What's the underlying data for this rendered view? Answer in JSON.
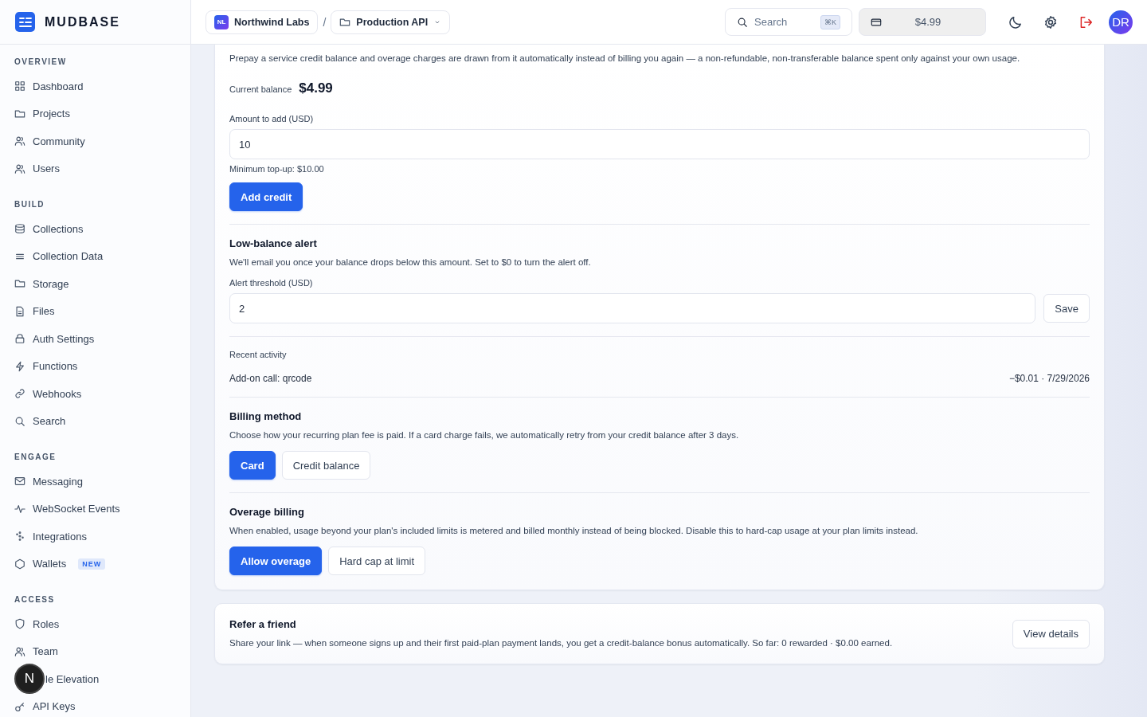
{
  "brand": {
    "name": "MUDBASE"
  },
  "sidebar": {
    "sections": [
      {
        "title": "OVERVIEW",
        "items": [
          {
            "label": "Dashboard"
          },
          {
            "label": "Projects"
          },
          {
            "label": "Community"
          },
          {
            "label": "Users"
          }
        ]
      },
      {
        "title": "BUILD",
        "items": [
          {
            "label": "Collections"
          },
          {
            "label": "Collection Data"
          },
          {
            "label": "Storage"
          },
          {
            "label": "Files"
          },
          {
            "label": "Auth Settings"
          },
          {
            "label": "Functions"
          },
          {
            "label": "Webhooks"
          },
          {
            "label": "Search"
          }
        ]
      },
      {
        "title": "ENGAGE",
        "items": [
          {
            "label": "Messaging"
          },
          {
            "label": "WebSocket Events"
          },
          {
            "label": "Integrations"
          },
          {
            "label": "Wallets",
            "badge": "NEW"
          }
        ]
      },
      {
        "title": "ACCESS",
        "items": [
          {
            "label": "Roles"
          },
          {
            "label": "Team"
          },
          {
            "label": "le Elevation",
            "covered_by": "N"
          },
          {
            "label": "API Keys"
          }
        ]
      }
    ]
  },
  "topbar": {
    "org": {
      "initials": "NL",
      "name": "Northwind Labs"
    },
    "separator": "/",
    "project": "Production API",
    "search": {
      "placeholder": "Search",
      "shortcut": "⌘K"
    },
    "balance": "$4.99",
    "avatar": "DR"
  },
  "credit": {
    "intro": "Prepay a service credit balance and overage charges are drawn from it automatically instead of billing you again — a non-refundable, non-transferable balance spent only against your own usage.",
    "balance_label": "Current balance",
    "balance": "$4.99",
    "amount_label": "Amount to add (USD)",
    "amount_value": "10",
    "hint": "Minimum top-up: $10.00",
    "add_button": "Add credit"
  },
  "alert": {
    "title": "Low-balance alert",
    "text": "We'll email you once your balance drops below this amount. Set to $0 to turn the alert off.",
    "label": "Alert threshold (USD)",
    "value": "2",
    "save_button": "Save"
  },
  "activity": {
    "title": "Recent activity",
    "rows": [
      {
        "name": "Add-on call: qrcode",
        "detail": "−$0.01 · 7/29/2026"
      }
    ]
  },
  "billing_method": {
    "title": "Billing method",
    "text": "Choose how your recurring plan fee is paid. If a card charge fails, we automatically retry from your credit balance after 3 days.",
    "options": [
      {
        "label": "Card",
        "selected": true
      },
      {
        "label": "Credit balance",
        "selected": false
      }
    ]
  },
  "overage": {
    "title": "Overage billing",
    "text": "When enabled, usage beyond your plan's included limits is metered and billed monthly instead of being blocked. Disable this to hard-cap usage at your plan limits instead.",
    "options": [
      {
        "label": "Allow overage",
        "selected": true
      },
      {
        "label": "Hard cap at limit",
        "selected": false
      }
    ]
  },
  "referral": {
    "title": "Refer a friend",
    "text": "Share your link — when someone signs up and their first paid-plan payment lands, you get a credit-balance bonus automatically. So far: 0 rewarded · $0.00 earned.",
    "button": "View details"
  }
}
